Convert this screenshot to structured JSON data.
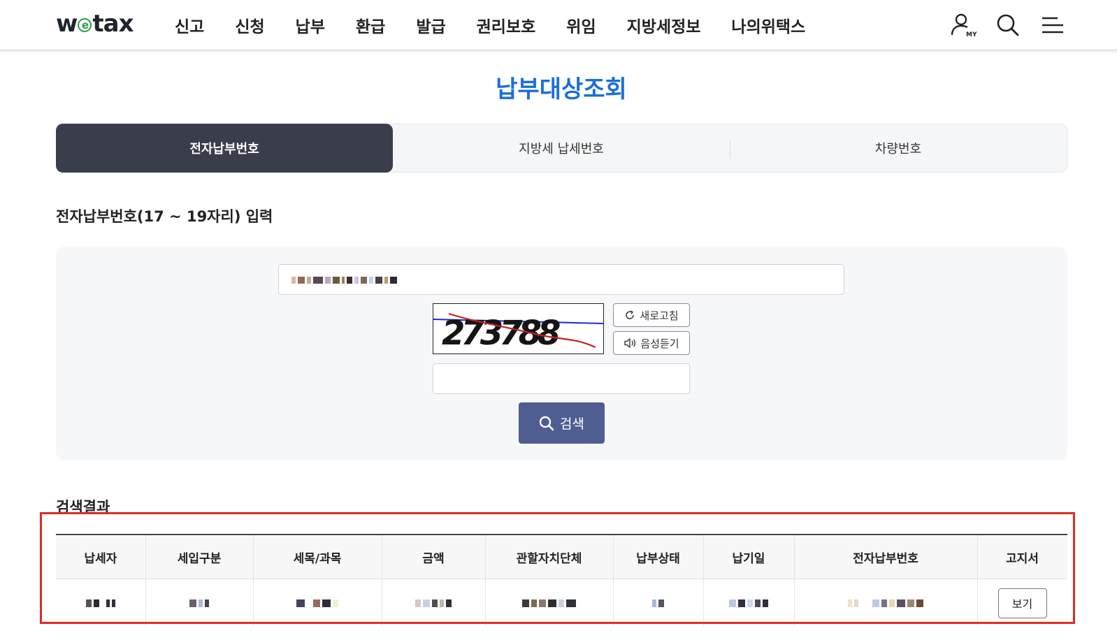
{
  "header": {
    "logo_pre": "w",
    "logo_e": "e",
    "logo_post": "tax",
    "nav": [
      "신고",
      "신청",
      "납부",
      "환급",
      "발급",
      "권리보호",
      "위임",
      "지방세정보",
      "나의위택스"
    ],
    "my_label": "MY"
  },
  "page": {
    "title": "납부대상조회"
  },
  "tabs": [
    {
      "label": "전자납부번호",
      "active": true
    },
    {
      "label": "지방세 납세번호",
      "active": false
    },
    {
      "label": "차량번호",
      "active": false
    }
  ],
  "form": {
    "section_label": "전자납부번호(17 ~ 19자리) 입력",
    "captcha_text": "273788",
    "refresh_label": "새로고침",
    "audio_label": "음성듣기",
    "search_label": "검색"
  },
  "results": {
    "label": "검색결과",
    "columns": [
      "납세자",
      "세입구분",
      "세목/과목",
      "금액",
      "관할자치단체",
      "납부상태",
      "납기일",
      "전자납부번호",
      "고지서"
    ],
    "view_label": "보기"
  },
  "colors": {
    "brand_blue": "#1a6fd8",
    "tab_active": "#3a3d4c",
    "search_button": "#4f5e90",
    "highlight": "#e02a2a",
    "logo_green": "#2aa14b"
  }
}
